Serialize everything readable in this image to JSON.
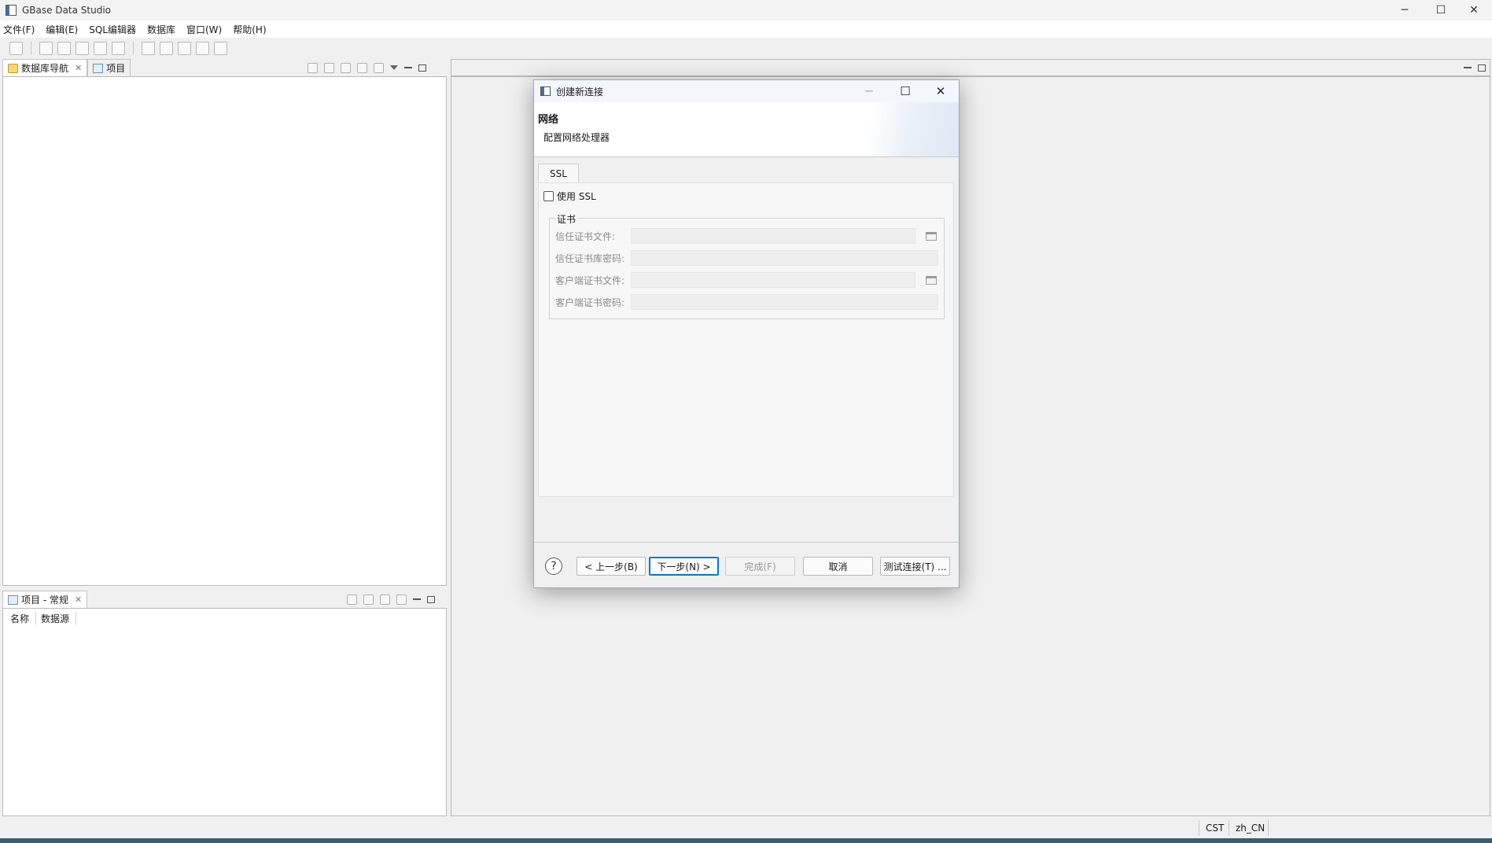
{
  "app": {
    "title": "GBase Data Studio"
  },
  "menubar": {
    "items": [
      "文件(F)",
      "编辑(E)",
      "SQL编辑器",
      "数据库",
      "窗口(W)",
      "帮助(H)"
    ]
  },
  "left_top_panel": {
    "tabs": [
      {
        "label": "数据库导航",
        "icon": "database-navigator-icon",
        "active": true
      },
      {
        "label": "项目",
        "icon": "project-icon",
        "active": false
      }
    ]
  },
  "left_bottom_panel": {
    "tab_label": "项目 - 常规",
    "columns": [
      "名称",
      "数据源"
    ]
  },
  "dialog": {
    "title": "创建新连接",
    "header_title": "网络",
    "header_desc": "配置网络处理器",
    "tab_label": "SSL",
    "use_ssl_label": "使用 SSL",
    "use_ssl_checked": false,
    "cert_group_label": "证书",
    "cert_fields": [
      {
        "label": "信任证书文件:",
        "value": "",
        "has_browse": true
      },
      {
        "label": "信任证书库密码:",
        "value": "",
        "has_browse": false
      },
      {
        "label": "客户端证书文件:",
        "value": "",
        "has_browse": true
      },
      {
        "label": "客户端证书密码:",
        "value": "",
        "has_browse": false
      }
    ],
    "buttons": {
      "back": "< 上一步(B)",
      "next": "下一步(N) >",
      "finish": "完成(F)",
      "cancel": "取消",
      "test": "测试连接(T) ..."
    }
  },
  "statusbar": {
    "timezone": "CST",
    "locale": "zh_CN"
  }
}
